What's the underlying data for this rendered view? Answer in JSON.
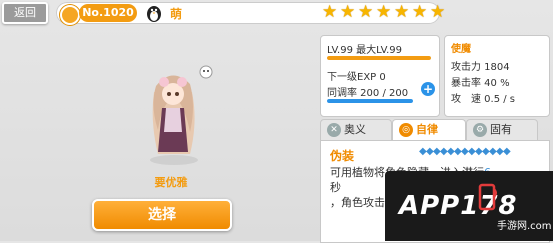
{
  "header": {
    "back_label": "返回",
    "number": "No.1020",
    "name": "萌",
    "star_count": 7,
    "star_glyph": "★"
  },
  "character": {
    "flower_name": "要优雅",
    "select_label": "选择"
  },
  "stats": {
    "level": "LV.99 最大LV.99",
    "next_exp": "下一级EXP 0",
    "sync_rate": "同调率 200 / 200",
    "plus": "+",
    "exp_progress": 1.0,
    "sync_progress": 1.0,
    "accent": "#f39c12",
    "bar_color": "#2b93e8"
  },
  "attributes": {
    "title": "使魔",
    "attack": "攻击力 1804",
    "crit": "暴击率 40 %",
    "speed": "攻　速 0.5 / s"
  },
  "tabs": [
    {
      "label": "奥义",
      "icon": "sword-icon"
    },
    {
      "label": "自律",
      "icon": "auto-icon"
    },
    {
      "label": "固有",
      "icon": "gear-icon"
    }
  ],
  "skill": {
    "name": "伪装",
    "gem_count": 13,
    "desc_1": "可用植物将角色隐藏，进入潜行",
    "desc_num": "6",
    "desc_2": "秒",
    "desc_3": "，角色攻击和绿化解除潜行"
  },
  "watermark": {
    "app": "APP178",
    "sub": "手游网",
    "domain": ".com"
  }
}
